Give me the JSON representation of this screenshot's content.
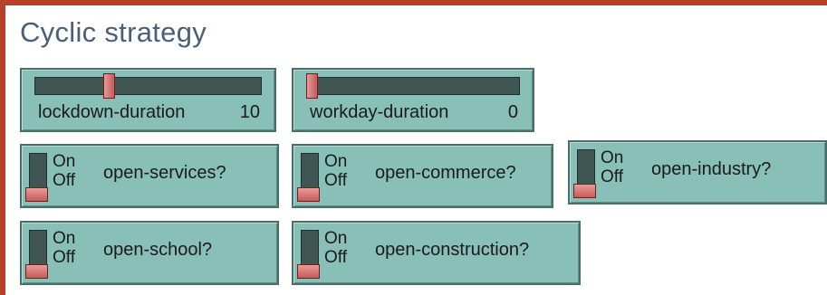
{
  "title": "Cyclic strategy",
  "colors": {
    "widget_background": "#88bfb6",
    "slider_track": "#3f5652",
    "thumb": "#c55a5a",
    "window_border": "#b8402a"
  },
  "sliders": [
    {
      "label": "lockdown-duration",
      "value": "10",
      "position_fraction": 0.32
    },
    {
      "label": "workday-duration",
      "value": "0",
      "position_fraction": 0.0
    }
  ],
  "switches": {
    "on_text": "On",
    "off_text": "Off",
    "items": [
      {
        "label": "open-services?",
        "state": "off"
      },
      {
        "label": "open-commerce?",
        "state": "off"
      },
      {
        "label": "open-industry?",
        "state": "off"
      },
      {
        "label": "open-school?",
        "state": "off"
      },
      {
        "label": "open-construction?",
        "state": "off"
      }
    ]
  }
}
